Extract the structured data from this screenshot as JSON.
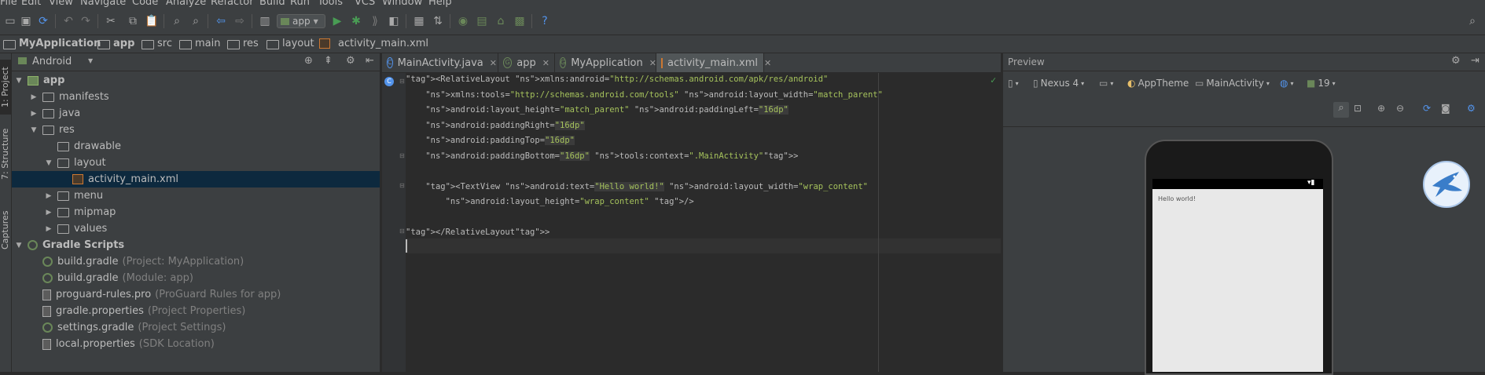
{
  "menu": [
    "File",
    "Edit",
    "View",
    "Navigate",
    "Code",
    "Analyze",
    "Refactor",
    "Build",
    "Run",
    "Tools",
    "VCS",
    "Window",
    "Help"
  ],
  "toolbar": {
    "run_config": "app"
  },
  "breadcrumb": [
    "MyApplication",
    "app",
    "src",
    "main",
    "res",
    "layout",
    "activity_main.xml"
  ],
  "left_strip": [
    "1: Project",
    "7: Structure",
    "Captures"
  ],
  "project": {
    "view_mode": "Android",
    "tree": [
      {
        "label": "app",
        "hint": "",
        "indent": 0,
        "arrow": "down",
        "icon": "app"
      },
      {
        "label": "manifests",
        "hint": "",
        "indent": 1,
        "arrow": "right",
        "icon": "fold"
      },
      {
        "label": "java",
        "hint": "",
        "indent": 1,
        "arrow": "right",
        "icon": "fold"
      },
      {
        "label": "res",
        "hint": "",
        "indent": 1,
        "arrow": "down",
        "icon": "fold"
      },
      {
        "label": "drawable",
        "hint": "",
        "indent": 2,
        "arrow": "",
        "icon": "fold"
      },
      {
        "label": "layout",
        "hint": "",
        "indent": 2,
        "arrow": "down",
        "icon": "fold"
      },
      {
        "label": "activity_main.xml",
        "hint": "",
        "indent": 3,
        "arrow": "",
        "icon": "xml",
        "selected": true
      },
      {
        "label": "menu",
        "hint": "",
        "indent": 2,
        "arrow": "right",
        "icon": "fold"
      },
      {
        "label": "mipmap",
        "hint": "",
        "indent": 2,
        "arrow": "right",
        "icon": "fold"
      },
      {
        "label": "values",
        "hint": "",
        "indent": 2,
        "arrow": "right",
        "icon": "fold"
      },
      {
        "label": "Gradle Scripts",
        "hint": "",
        "indent": 0,
        "arrow": "down",
        "icon": "grad"
      },
      {
        "label": "build.gradle",
        "hint": "(Project: MyApplication)",
        "indent": 1,
        "arrow": "",
        "icon": "grad"
      },
      {
        "label": "build.gradle",
        "hint": "(Module: app)",
        "indent": 1,
        "arrow": "",
        "icon": "grad"
      },
      {
        "label": "proguard-rules.pro",
        "hint": "(ProGuard Rules for app)",
        "indent": 1,
        "arrow": "",
        "icon": "prop"
      },
      {
        "label": "gradle.properties",
        "hint": "(Project Properties)",
        "indent": 1,
        "arrow": "",
        "icon": "prop"
      },
      {
        "label": "settings.gradle",
        "hint": "(Project Settings)",
        "indent": 1,
        "arrow": "",
        "icon": "grad"
      },
      {
        "label": "local.properties",
        "hint": "(SDK Location)",
        "indent": 1,
        "arrow": "",
        "icon": "prop"
      }
    ]
  },
  "tabs": [
    {
      "label": "MainActivity.java",
      "active": false
    },
    {
      "label": "app",
      "active": false
    },
    {
      "label": "MyApplication",
      "active": false
    },
    {
      "label": "activity_main.xml",
      "active": true
    }
  ],
  "code": [
    "<RelativeLayout xmlns:android=\"http://schemas.android.com/apk/res/android\"",
    "    xmlns:tools=\"http://schemas.android.com/tools\" android:layout_width=\"match_parent\"",
    "    android:layout_height=\"match_parent\" android:paddingLeft=\"16dp\"",
    "    android:paddingRight=\"16dp\"",
    "    android:paddingTop=\"16dp\"",
    "    android:paddingBottom=\"16dp\" tools:context=\".MainActivity\">",
    "",
    "    <TextView android:text=\"Hello world!\" android:layout_width=\"wrap_content\"",
    "        android:layout_height=\"wrap_content\" />",
    "",
    "</RelativeLayout>",
    ""
  ],
  "preview": {
    "title": "Preview",
    "device": "Nexus 4",
    "theme": "AppTheme",
    "activity": "MainActivity",
    "api": "19",
    "hello_text": "Hello world!"
  }
}
